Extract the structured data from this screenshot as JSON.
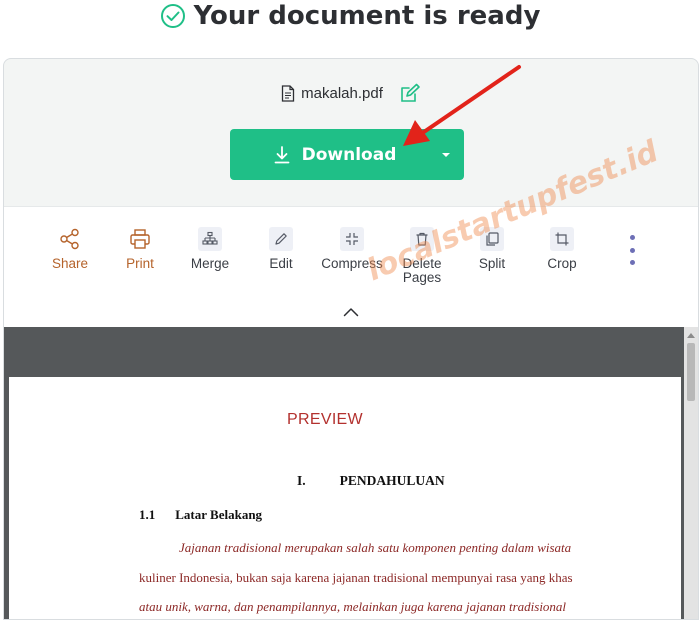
{
  "header": {
    "title": "Your document is ready"
  },
  "file": {
    "name": "makalah.pdf"
  },
  "download": {
    "label": "Download"
  },
  "tools": [
    {
      "label": "Share",
      "icon": "share-icon"
    },
    {
      "label": "Print",
      "icon": "print-icon"
    },
    {
      "label": "Merge",
      "icon": "merge-icon"
    },
    {
      "label": "Edit",
      "icon": "edit-icon"
    },
    {
      "label": "Compress",
      "icon": "compress-icon"
    },
    {
      "label": "Delete Pages",
      "icon": "trash-icon"
    },
    {
      "label": "Split",
      "icon": "split-icon"
    },
    {
      "label": "Crop",
      "icon": "crop-icon"
    }
  ],
  "preview": {
    "label": "PREVIEW",
    "section_num": "I.",
    "section_title": "PENDAHULUAN",
    "sub_num": "1.1",
    "sub_title": "Latar Belakang",
    "lines": [
      "Jajanan tradisional merupakan salah satu komponen penting dalam wisata",
      "kuliner Indonesia, bukan saja karena jajanan tradisional mempunyai rasa yang khas",
      "atau unik, warna, dan penampilannya, melainkan juga karena jajanan tradisional"
    ]
  },
  "watermark": {
    "text": "localstartupfest.id"
  },
  "colors": {
    "accent": "#1fbf87",
    "share_print": "#b5632b",
    "tool_text": "#3b3f46",
    "preview_red": "#b3312e",
    "arrow": "#e2231a"
  }
}
